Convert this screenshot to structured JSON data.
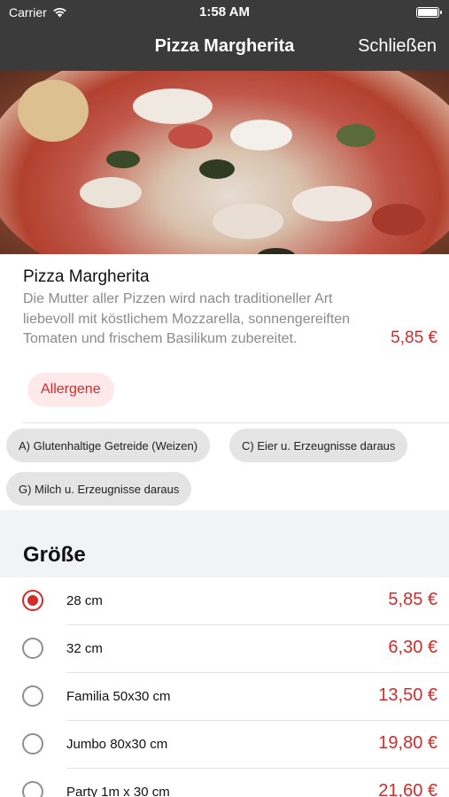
{
  "status_bar": {
    "carrier": "Carrier",
    "time": "1:58 AM"
  },
  "nav": {
    "title": "Pizza Margherita",
    "close_label": "Schließen"
  },
  "product": {
    "name": "Pizza Margherita",
    "description": "Die Mutter aller Pizzen wird nach traditioneller Art liebevoll mit köstlichem Mozzarella, sonnengereiften Tomaten und frischem Basilikum zubereitet.",
    "price": "5,85 €",
    "allergens_button": "Allergene"
  },
  "allergens": [
    "A) Glutenhaltige Getreide (Weizen)",
    "C) Eier u. Erzeugnisse daraus",
    "G) Milch u. Erzeugnisse daraus"
  ],
  "size_section": {
    "title": "Größe",
    "options": [
      {
        "label": "28 cm",
        "price": "5,85 €",
        "selected": true
      },
      {
        "label": "32 cm",
        "price": "6,30 €",
        "selected": false
      },
      {
        "label": "Familia 50x30 cm",
        "price": "13,50 €",
        "selected": false
      },
      {
        "label": "Jumbo 80x30 cm",
        "price": "19,80 €",
        "selected": false
      },
      {
        "label": "Party 1m x 30 cm",
        "price": "21,60 €",
        "selected": false
      }
    ]
  },
  "colors": {
    "bar": "#3b3b3b",
    "accent": "#d42a2a",
    "chip": "#e4e4e4",
    "section": "#f2f3f5"
  }
}
